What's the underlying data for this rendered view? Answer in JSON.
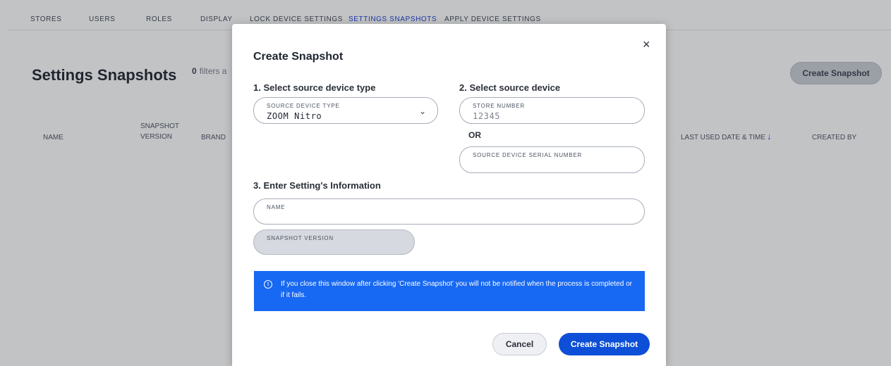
{
  "tabs": [
    {
      "label": "STORES"
    },
    {
      "label": "USERS"
    },
    {
      "label": "ROLES"
    },
    {
      "label": "DISPLAY"
    },
    {
      "label": "LOCK DEVICE SETTINGS"
    },
    {
      "label": "SETTINGS SNAPSHOTS",
      "active": true
    },
    {
      "label": "APPLY DEVICE SETTINGS"
    }
  ],
  "page": {
    "title": "Settings Snapshots",
    "filters_count": "0",
    "filters_text": "filters a",
    "create_button": "Create Snapshot"
  },
  "table": {
    "columns": {
      "name": "NAME",
      "snapshot": "SNAPSHOT",
      "version": "VERSION",
      "brand": "BRAND",
      "last_used": "LAST USED DATE & TIME",
      "created_by": "CREATED BY"
    },
    "sort_icon": "arrow-down-icon"
  },
  "modal": {
    "title": "Create Snapshot",
    "close_glyph": "×",
    "step1": "1. Select source device type",
    "step2": "2. Select source device",
    "step3": "3. Enter Setting's Information",
    "device_type": {
      "label": "SOURCE DEVICE TYPE",
      "value": "ZOOM Nitro"
    },
    "store_number": {
      "label": "STORE NUMBER",
      "placeholder": "12345"
    },
    "or_text": "OR",
    "serial_number": {
      "label": "SOURCE DEVICE SERIAL NUMBER",
      "value": ""
    },
    "name_field": {
      "label": "NAME",
      "value": ""
    },
    "snapshot_version": {
      "label": "SNAPSHOT VERSION",
      "value": ""
    },
    "info_text": "If you close this window after clicking 'Create Snapshot' you will not be notified when the process is completed or if it fails.",
    "cancel_label": "Cancel",
    "create_label": "Create Snapshot"
  },
  "colors": {
    "primary": "#0d4fd6",
    "info_banner": "#1768f2",
    "active_tab": "#1a3fd6"
  }
}
